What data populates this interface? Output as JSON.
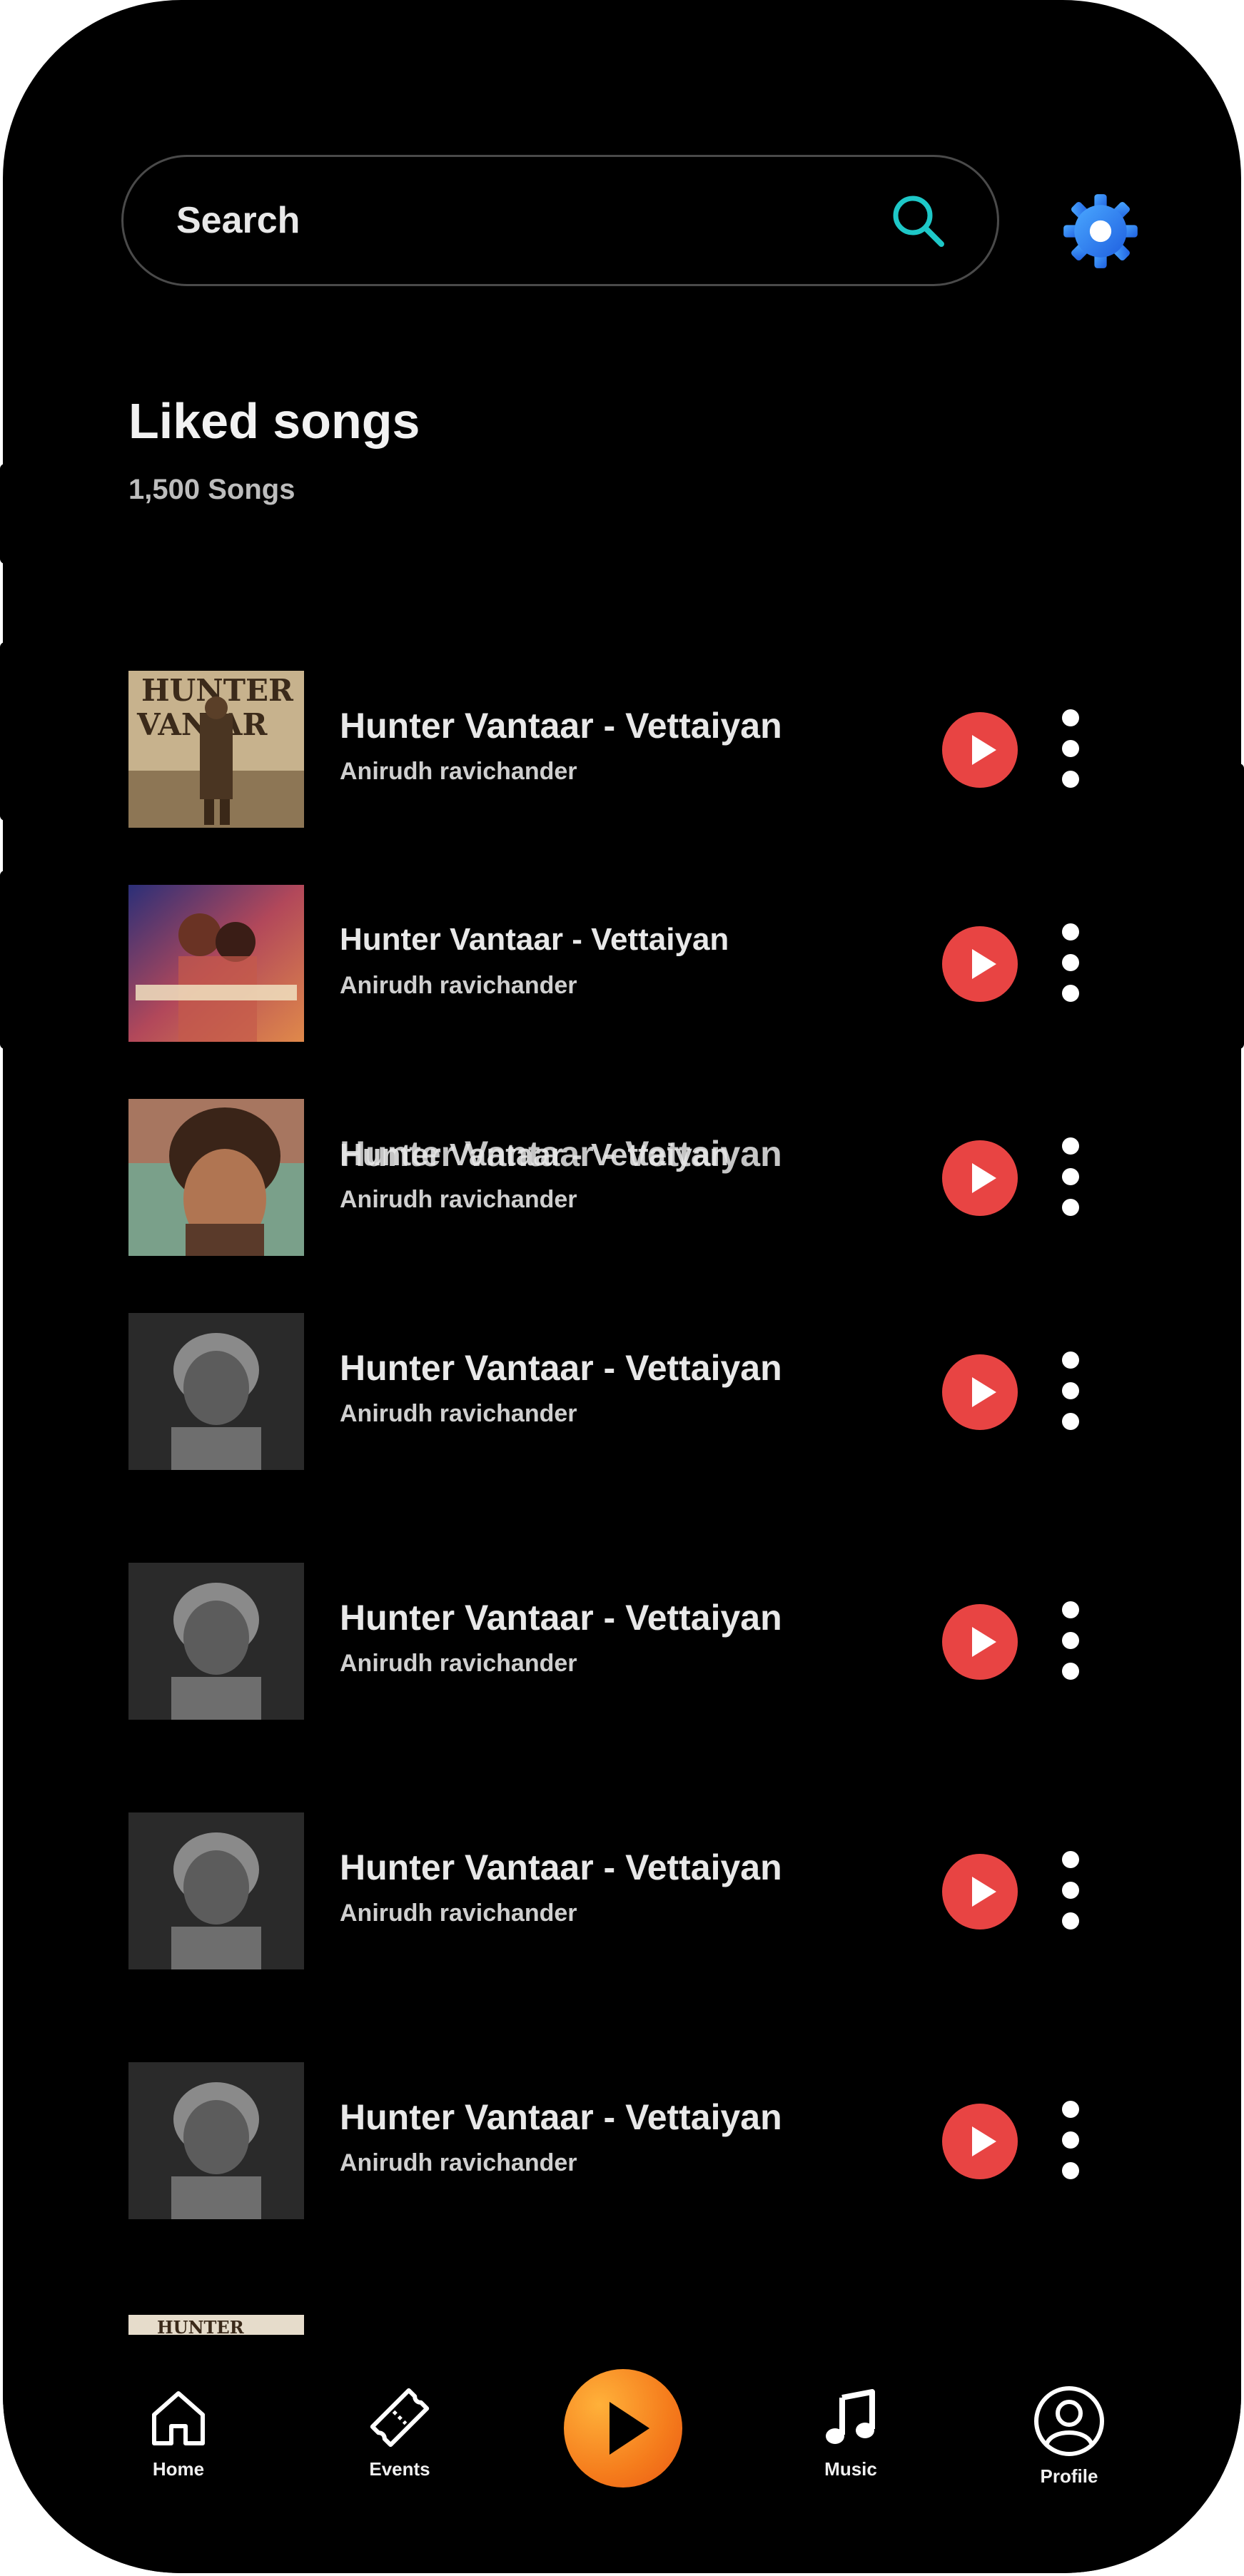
{
  "search": {
    "placeholder": "Search",
    "accent_color": "#1ec8c8"
  },
  "settings": {
    "icon": "gear-icon",
    "color": "#2f7cf6"
  },
  "section": {
    "title": "Liked songs",
    "count": "1,500 Songs"
  },
  "songs": [
    {
      "title": "Hunter Vantaar - Vettaiyan",
      "artist": "Anirudh ravichander",
      "cover": "hunter-vantaar-poster"
    },
    {
      "title": "Hunter Vantaar - Vettaiyan",
      "artist": "Anirudh ravichander",
      "cover": "couple-poster"
    },
    {
      "title": "Hunter Vantaar - Vettaiyan",
      "artist": "Anirudh ravichander",
      "cover": "bearded-actor-portrait"
    },
    {
      "title": "Hunter Vantaar - Vettaiyan",
      "artist": "Anirudh ravichander",
      "cover": "monochrome-portrait"
    },
    {
      "title": "Hunter Vantaar - Vettaiyan",
      "artist": "Anirudh ravichander",
      "cover": "monochrome-portrait"
    },
    {
      "title": "Hunter Vantaar - Vettaiyan",
      "artist": "Anirudh ravichander",
      "cover": "monochrome-portrait"
    },
    {
      "title": "Hunter Vantaar - Vettaiyan",
      "artist": "Anirudh ravichander",
      "cover": "monochrome-portrait"
    }
  ],
  "overlap_ghost_title": "Hunter Vantaar - Vettaiyan",
  "colors": {
    "play_button": "#e84443",
    "background": "#000000",
    "nav_center_gradient": [
      "#ffb13a",
      "#ea5a14"
    ]
  },
  "nav": {
    "items": [
      {
        "label": "Home",
        "icon": "home-icon"
      },
      {
        "label": "Events",
        "icon": "ticket-icon"
      },
      {
        "label": "",
        "icon": "play-icon"
      },
      {
        "label": "Music",
        "icon": "music-note-icon"
      },
      {
        "label": "Profile",
        "icon": "profile-icon"
      }
    ]
  }
}
